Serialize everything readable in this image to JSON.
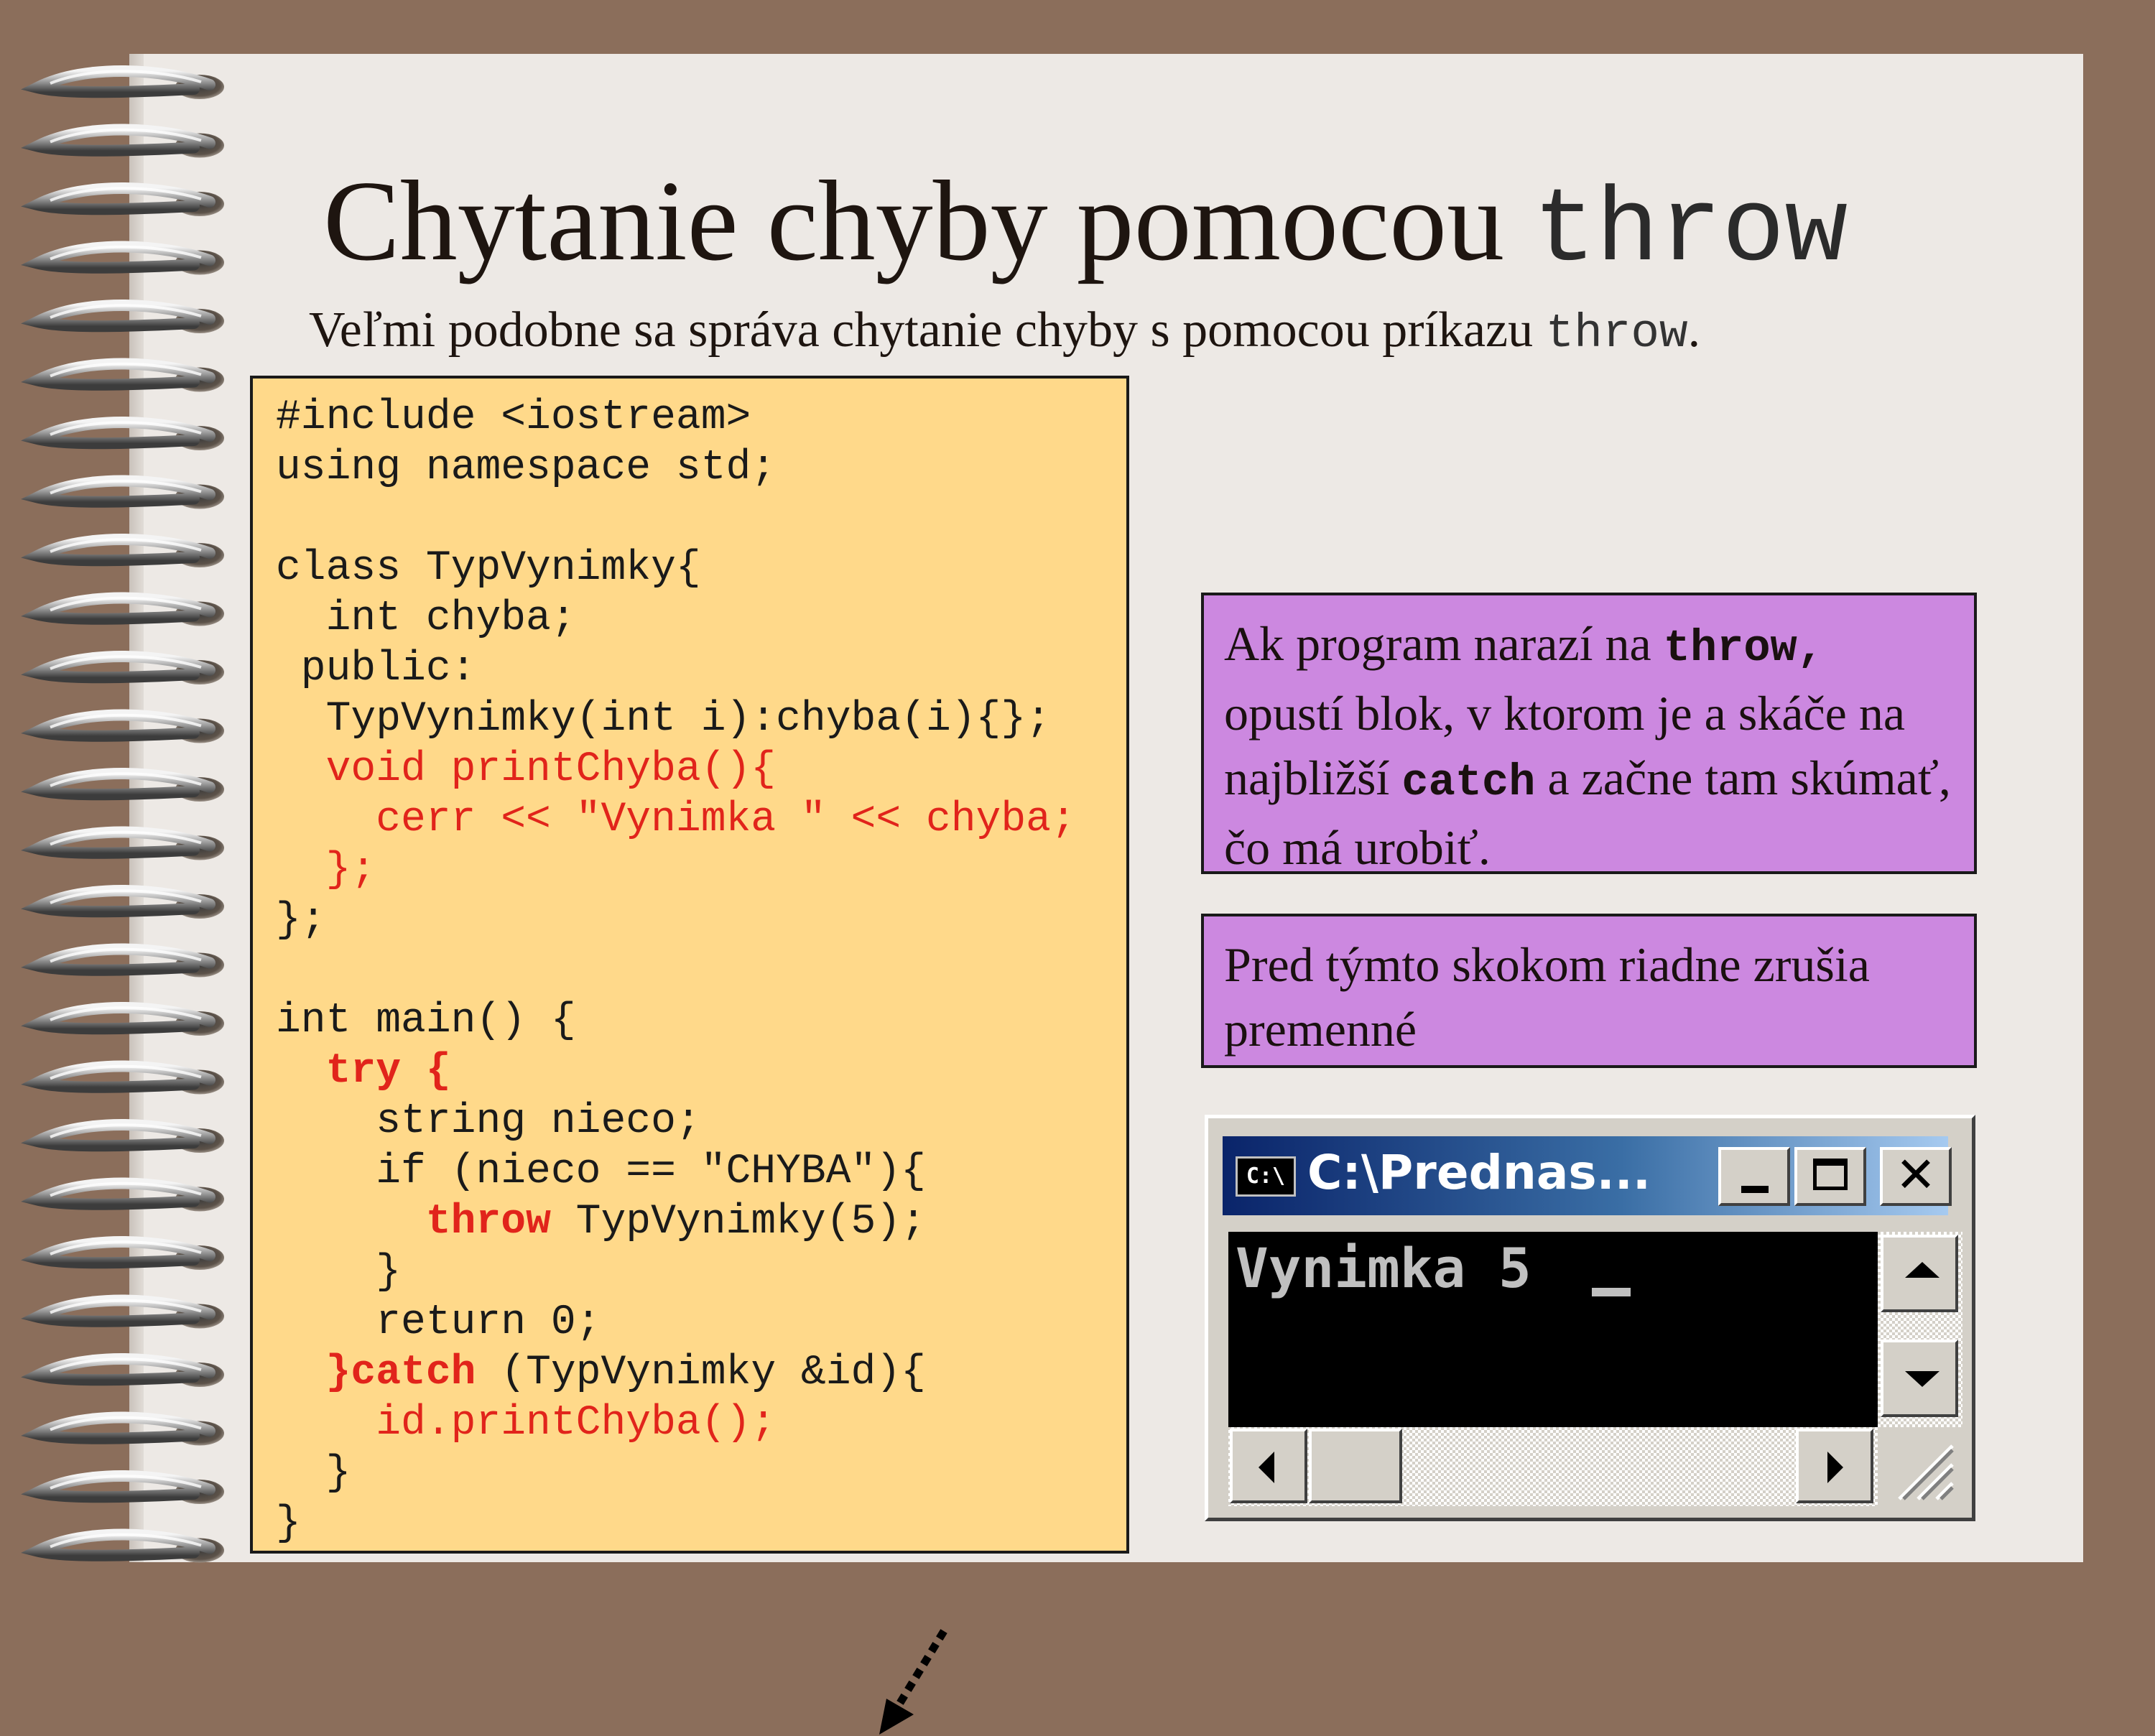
{
  "slide": {
    "title_main": "Chytanie chyby  pomocou ",
    "title_code": "throw",
    "subtitle_text": "Veľmi podobne sa správa chytanie chyby s pomocou príkazu ",
    "subtitle_code": "throw",
    "subtitle_end": "."
  },
  "code_lines": [
    "#include <iostream>",
    "using namespace std;",
    "",
    "class TypVynimky{",
    "  int chyba;",
    " public:",
    "  TypVynimky(int i):chyba(i){};",
    "  void printChyba(){",
    "    cerr << \"Vynimka \" << chyba;",
    "  };",
    "};",
    "",
    "int main() {",
    "  try {",
    "    string nieco;",
    "    if (nieco == \"CHYBA\"){",
    "      throw TypVynimky(5);",
    "    }",
    "    return 0;",
    "  }catch (TypVynimky &id){",
    "    id.printChyba();",
    "  }",
    "}"
  ],
  "note1": {
    "t1": "Ak program narazí na ",
    "k1": "throw,",
    "t2": "opustí blok, v ktorom je a skáče na najbližší ",
    "k2": "catch",
    "t3": " a začne tam skúmať, čo má urobiť."
  },
  "note2": {
    "text": "Pred týmto skokom riadne zrušia premenné"
  },
  "console": {
    "icon_text": "C:\\",
    "title": "C:\\Prednas...",
    "output": "Vynimka 5"
  },
  "colors": {
    "background": "#8b6e5b",
    "paper": "#ede9e5",
    "code_box": "#ffd98a",
    "note_box": "#cc88e0",
    "code_red": "#e1241b"
  }
}
